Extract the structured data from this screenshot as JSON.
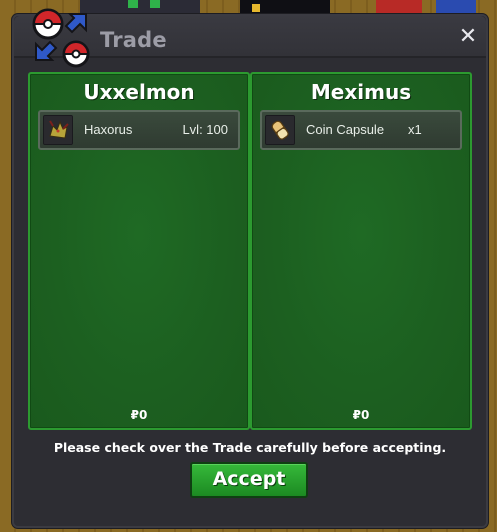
{
  "window": {
    "title": "Trade",
    "close_label": "✕",
    "notice": "Please check over the Trade carefully before accepting.",
    "accept_label": "Accept"
  },
  "offers": [
    {
      "player": "Uxxelmon",
      "items": [
        {
          "icon": "haxorus-icon",
          "name": "Haxorus",
          "extra": "Lvl: 100"
        }
      ],
      "money": "₽0"
    },
    {
      "player": "Meximus",
      "items": [
        {
          "icon": "coin-capsule-icon",
          "name": "Coin Capsule",
          "extra": "x1"
        }
      ],
      "money": "₽0"
    }
  ],
  "colors": {
    "panel_green": "#1c5f20",
    "panel_border": "#2c9a30",
    "accept_green": "#2aa72f",
    "window_bg": "#2d2d33",
    "title_text": "#9c9ca6"
  }
}
